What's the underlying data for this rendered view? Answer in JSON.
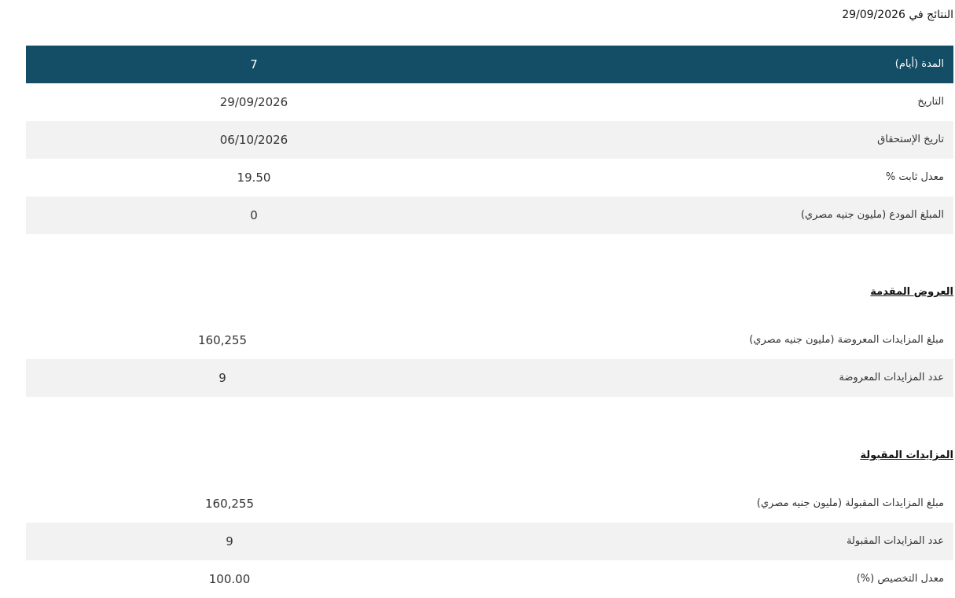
{
  "results_date_heading": "النتائج في 29/09/2026",
  "summary": {
    "header": {
      "label": "المدة (أيام)",
      "value": "7"
    },
    "rows": [
      {
        "label": "التاريخ",
        "value": "29/09/2026"
      },
      {
        "label": "تاريخ الإستحقاق",
        "value": "06/10/2026"
      },
      {
        "label": "معدل ثابت %",
        "value": "19.50"
      },
      {
        "label": "المبلغ المودع (مليون جنيه مصري)",
        "value": "0"
      }
    ]
  },
  "offers": {
    "title": "العروض المقدمة",
    "rows": [
      {
        "label": "مبلغ المزايدات المعروضة (مليون جنيه مصري)",
        "value": "160,255"
      },
      {
        "label": "عدد المزايدات المعروضة",
        "value": "9"
      }
    ]
  },
  "accepted": {
    "title": "المزايدات المقبولة",
    "rows": [
      {
        "label": "مبلغ المزايدات المقبولة (مليون جنيه مصري)",
        "value": "160,255"
      },
      {
        "label": "عدد المزايدات المقبولة",
        "value": "9"
      },
      {
        "label": "معدل التخصيص (%)",
        "value": "100.00"
      }
    ]
  },
  "colors": {
    "header_bg": "#134d66",
    "row_shade": "#f2f2f2"
  }
}
